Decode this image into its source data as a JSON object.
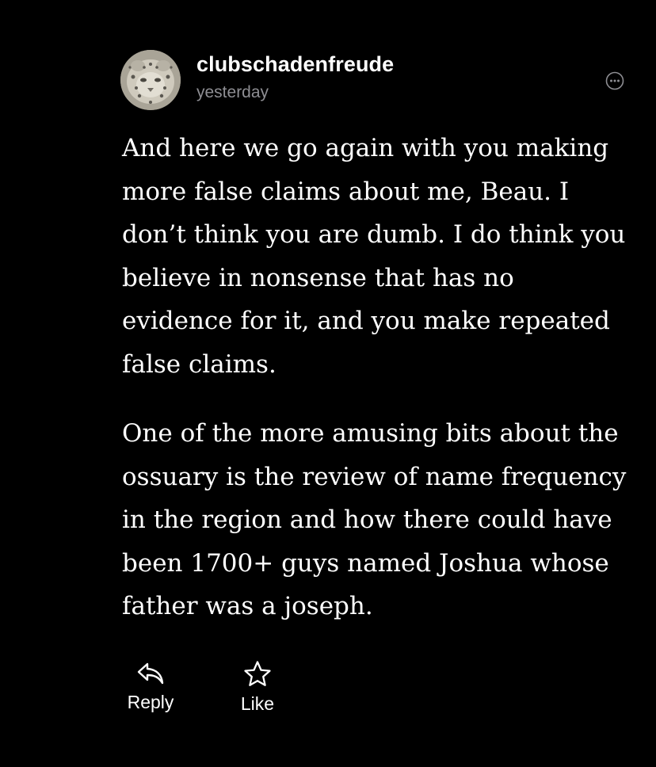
{
  "post": {
    "author": "clubschadenfreude",
    "timestamp": "yesterday",
    "avatar_icon": "snow-leopard-avatar",
    "more_icon": "ellipsis-circle-icon",
    "paragraphs": [
      "And here we go again with you making more false claims about me, Beau. I don’t think you are dumb. I do think you believe in nonsense that has no evidence for it, and you make repeated false claims.",
      "One of the more amusing bits about the ossuary is the review of name frequency in the region and how there could have been 1700+ guys named Joshua whose father was a joseph."
    ]
  },
  "actions": {
    "reply_label": "Reply",
    "reply_icon": "reply-arrow-icon",
    "like_label": "Like",
    "like_icon": "star-icon"
  },
  "colors": {
    "background": "#000000",
    "text": "#ffffff",
    "muted": "#8e8e93"
  }
}
